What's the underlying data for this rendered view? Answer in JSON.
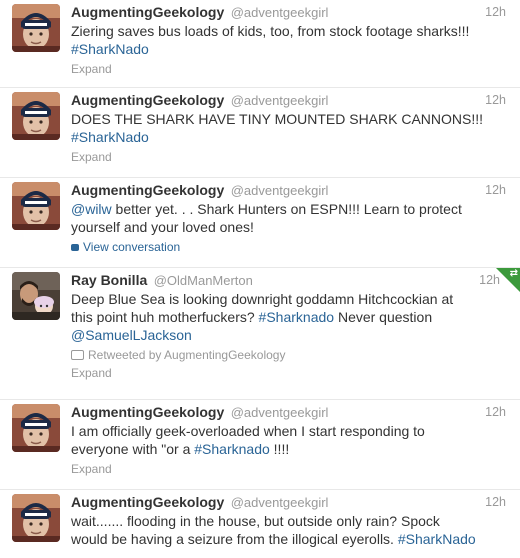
{
  "tweets": [
    {
      "fullname": "AugmentingGeekology",
      "username": "@adventgeekgirl",
      "time": "12h",
      "avatar": "geek-avatar",
      "lines": [
        [
          {
            "t": "Ziering saves bus loads of kids, too, from stock footage sharks!!!"
          }
        ],
        [
          {
            "t": "#SharkNado",
            "k": "tag"
          }
        ]
      ],
      "footer": {
        "type": "expand",
        "label": "Expand"
      }
    },
    {
      "fullname": "AugmentingGeekology",
      "username": "@adventgeekgirl",
      "time": "12h",
      "avatar": "geek-avatar",
      "lines": [
        [
          {
            "t": "DOES THE SHARK HAVE TINY MOUNTED SHARK CANNONS!!!"
          }
        ],
        [
          {
            "t": "#SharkNado",
            "k": "tag"
          }
        ]
      ],
      "footer": {
        "type": "expand",
        "label": "Expand"
      }
    },
    {
      "fullname": "AugmentingGeekology",
      "username": "@adventgeekgirl",
      "time": "12h",
      "avatar": "geek-avatar",
      "lines": [
        [
          {
            "t": "@wilw",
            "k": "mention"
          },
          {
            "t": " better yet. . . Shark Hunters on ESPN!!! Learn to protect"
          }
        ],
        [
          {
            "t": "yourself and your loved ones!"
          }
        ]
      ],
      "footer": {
        "type": "conversation",
        "label": "View conversation"
      }
    },
    {
      "fullname": "Ray Bonilla",
      "username": "@OldManMerton",
      "time": "12h",
      "avatar": "ray-avatar",
      "retweeted_corner": true,
      "lines": [
        [
          {
            "t": "Deep Blue Sea is looking downright goddamn Hitchcockian at"
          }
        ],
        [
          {
            "t": "this point huh motherfuckers? "
          },
          {
            "t": "#Sharknado",
            "k": "tag"
          },
          {
            "t": " Never question"
          }
        ],
        [
          {
            "t": "@SamuelLJackson",
            "k": "mention"
          }
        ]
      ],
      "retweet_line": "Retweeted by AugmentingGeekology",
      "footer": {
        "type": "expand",
        "label": "Expand"
      }
    },
    {
      "fullname": "AugmentingGeekology",
      "username": "@adventgeekgirl",
      "time": "12h",
      "avatar": "geek-avatar",
      "lines": [
        [
          {
            "t": "I am officially geek-overloaded when I start responding to"
          }
        ],
        [
          {
            "t": "everyone with \"or a "
          },
          {
            "t": "#Sharknado",
            "k": "tag"
          },
          {
            "t": " !!!!"
          }
        ]
      ],
      "footer": {
        "type": "expand",
        "label": "Expand"
      }
    },
    {
      "fullname": "AugmentingGeekology",
      "username": "@adventgeekgirl",
      "time": "12h",
      "avatar": "geek-avatar",
      "lines": [
        [
          {
            "t": "wait....... flooding in the house, but outside only rain? Spock"
          }
        ],
        [
          {
            "t": "would be having a seizure from the illogical eyerolls. "
          },
          {
            "t": "#SharkNado",
            "k": "tag"
          }
        ]
      ],
      "footer": null
    }
  ]
}
